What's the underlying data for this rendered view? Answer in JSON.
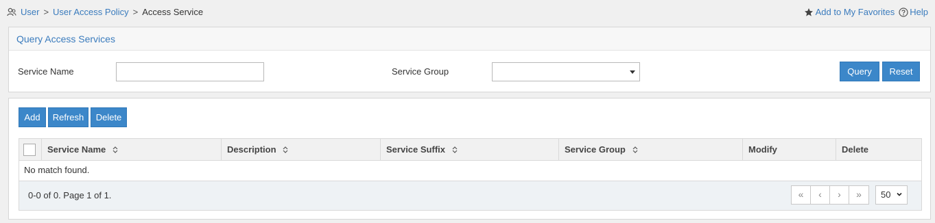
{
  "breadcrumb": {
    "items": [
      "User",
      "User Access Policy"
    ],
    "separator": ">",
    "current": "Access Service"
  },
  "top_links": {
    "favorites": "Add to My Favorites",
    "help": "Help"
  },
  "query": {
    "title": "Query Access Services",
    "service_name_label": "Service Name",
    "service_name_value": "",
    "service_group_label": "Service Group",
    "service_group_value": "",
    "query_button": "Query",
    "reset_button": "Reset"
  },
  "toolbar": {
    "add": "Add",
    "refresh": "Refresh",
    "delete": "Delete"
  },
  "table": {
    "columns": [
      "Service Name",
      "Description",
      "Service Suffix",
      "Service Group",
      "Modify",
      "Delete"
    ],
    "sortable": [
      true,
      true,
      true,
      true,
      false,
      false
    ],
    "empty_message": "No match found.",
    "summary": "0-0 of 0. Page 1 of 1.",
    "page_size": "50"
  },
  "icons": [
    "users-icon",
    "star-icon",
    "help-icon",
    "sort-icon",
    "first-page-icon",
    "prev-page-icon",
    "next-page-icon",
    "last-page-icon",
    "chevron-down-icon"
  ],
  "colors": {
    "accent": "#3c87c9",
    "link": "#3a7bbd",
    "background": "#f0f0f0"
  }
}
